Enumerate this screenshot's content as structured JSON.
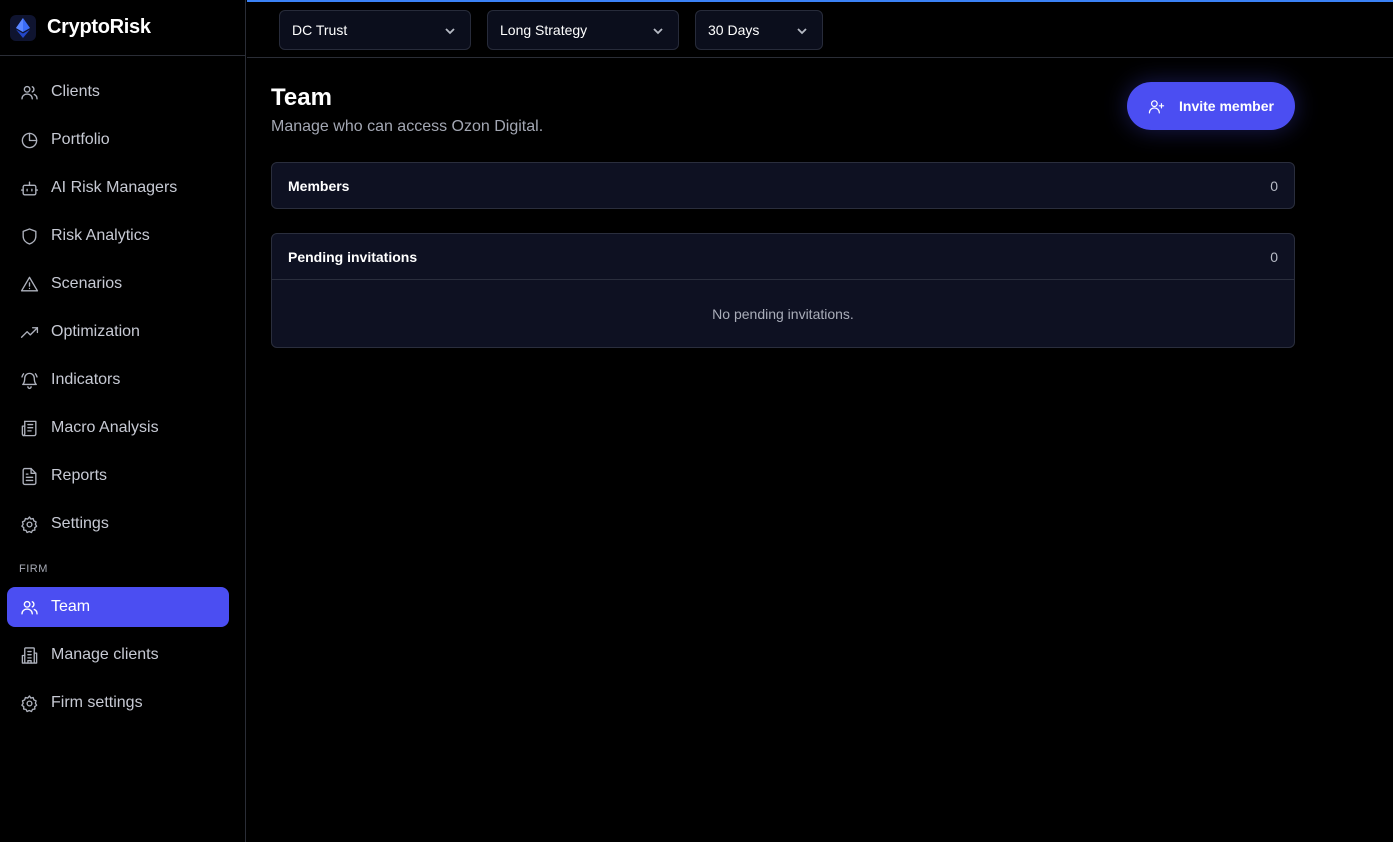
{
  "brand": {
    "name": "CryptoRisk"
  },
  "sidebar": {
    "items": [
      {
        "label": "Clients",
        "icon": "users-icon"
      },
      {
        "label": "Portfolio",
        "icon": "pie-chart-icon"
      },
      {
        "label": "AI Risk Managers",
        "icon": "bot-icon"
      },
      {
        "label": "Risk Analytics",
        "icon": "shield-icon"
      },
      {
        "label": "Scenarios",
        "icon": "warning-triangle-icon"
      },
      {
        "label": "Optimization",
        "icon": "trending-up-icon"
      },
      {
        "label": "Indicators",
        "icon": "bell-icon"
      },
      {
        "label": "Macro Analysis",
        "icon": "newspaper-icon"
      },
      {
        "label": "Reports",
        "icon": "file-text-icon"
      },
      {
        "label": "Settings",
        "icon": "gear-icon"
      }
    ],
    "firm_section_label": "FIRM",
    "firm_items": [
      {
        "label": "Team",
        "icon": "users-icon",
        "active": true
      },
      {
        "label": "Manage clients",
        "icon": "building-icon"
      },
      {
        "label": "Firm settings",
        "icon": "gear-icon"
      }
    ]
  },
  "topbar": {
    "client_select": "DC Trust",
    "strategy_select": "Long Strategy",
    "period_select": "30 Days"
  },
  "page": {
    "title": "Team",
    "subtitle": "Manage who can access Ozon Digital.",
    "invite_label": "Invite member"
  },
  "members": {
    "title": "Members",
    "count": "0"
  },
  "pending": {
    "title": "Pending invitations",
    "count": "0",
    "empty_text": "No pending invitations."
  },
  "colors": {
    "accent": "#4b4ef2",
    "topbar_accent": "#3b82f6",
    "background": "#000000",
    "card": "#0e1122"
  }
}
